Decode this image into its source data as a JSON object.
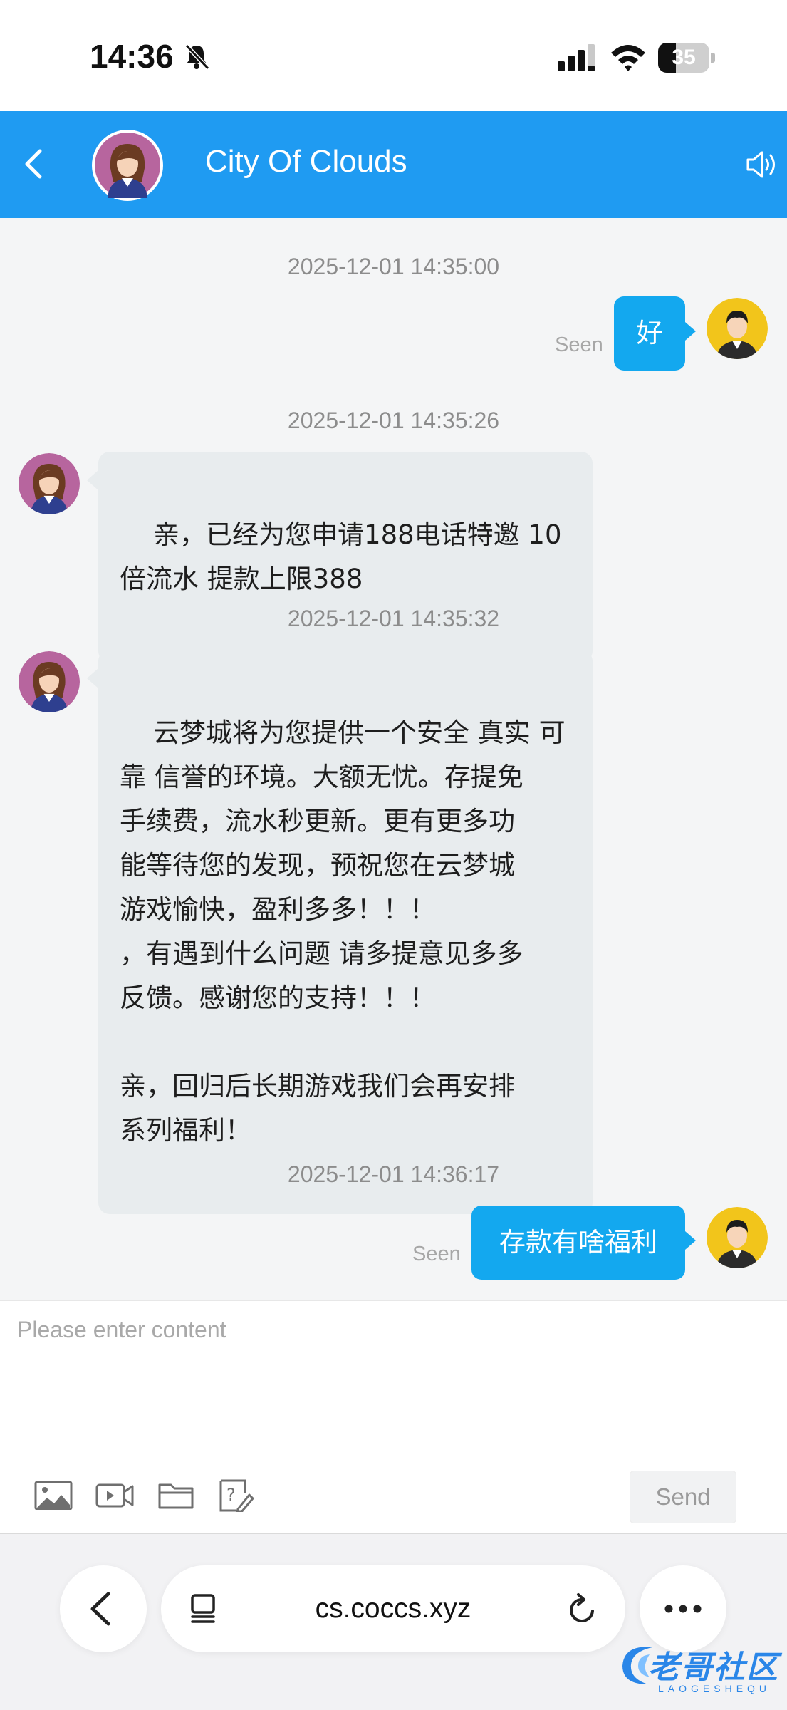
{
  "status_bar": {
    "time": "14:36",
    "battery": "35",
    "battery_level_percent": 35
  },
  "header": {
    "title": "City Of Clouds"
  },
  "messages": [
    {
      "timestamp": "2025-12-01 14:35:00",
      "direction": "out",
      "text": "好",
      "status": "Seen"
    },
    {
      "timestamp": "2025-12-01 14:35:26",
      "direction": "in",
      "text": "亲，已经为您申请188电话特邀 10\n倍流水 提款上限388"
    },
    {
      "timestamp": "2025-12-01 14:35:32",
      "direction": "in",
      "text": "云梦城将为您提供一个安全 真实 可\n靠 信誉的环境。大额无忧。存提免\n手续费，流水秒更新。更有更多功\n能等待您的发现，预祝您在云梦城\n游戏愉快，盈利多多！！！\n，有遇到什么问题 请多提意见多多\n反馈。感谢您的支持！！！\n\n亲，回归后长期游戏我们会再安排\n系列福利！"
    },
    {
      "timestamp": "2025-12-01 14:36:17",
      "direction": "out",
      "text": "存款有啥福利",
      "status": "Seen"
    }
  ],
  "composer": {
    "placeholder": "Please enter content",
    "send_label": "Send",
    "tools": [
      "image-icon",
      "video-icon",
      "folder-icon",
      "question-edit-icon"
    ]
  },
  "browser": {
    "url": "cs.coccs.xyz"
  },
  "watermark": {
    "text": "老哥社区",
    "subtext": "LAOGESHEQU"
  },
  "colors": {
    "header": "#1f9bf2",
    "outgoing_bubble": "#13a8ef",
    "incoming_bubble": "#e8ecee"
  }
}
